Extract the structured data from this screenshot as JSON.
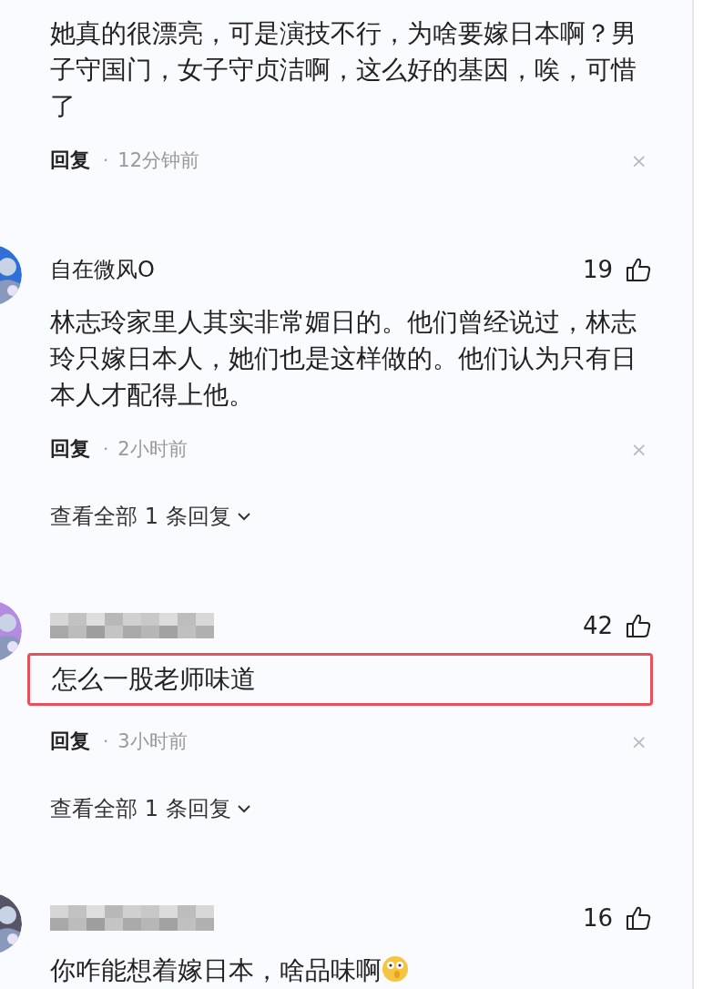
{
  "comments": [
    {
      "has_avatar": false,
      "text": "她真的很漂亮，可是演技不行，为啥要嫁日本啊？男子守国门，女子守贞洁啊，这么好的基因，唉，可惜了",
      "highlighted": false,
      "emoji": false,
      "reply": "回复",
      "dot": "·",
      "time": "12分钟前",
      "close": "×"
    },
    {
      "has_avatar": true,
      "author": {
        "blurred": false,
        "name": "自在微风O"
      },
      "likes": "19",
      "text": "林志玲家里人其实非常媚日的。他们曾经说过，林志玲只嫁日本人，她们也是这样做的。他们认为只有日本人才配得上他。",
      "highlighted": false,
      "emoji": false,
      "reply": "回复",
      "dot": "·",
      "time": "2小时前",
      "close": "×",
      "view_all": "查看全部 1 条回复"
    },
    {
      "has_avatar": true,
      "author": {
        "blurred": true
      },
      "likes": "42",
      "text": "怎么一股老师味道",
      "highlighted": true,
      "emoji": false,
      "reply": "回复",
      "dot": "·",
      "time": "3小时前",
      "close": "×",
      "view_all": "查看全部 1 条回复"
    },
    {
      "has_avatar": true,
      "author": {
        "blurred": true
      },
      "likes": "16",
      "text": "你咋能想着嫁日本，啥品味啊",
      "highlighted": false,
      "emoji": true
    }
  ]
}
